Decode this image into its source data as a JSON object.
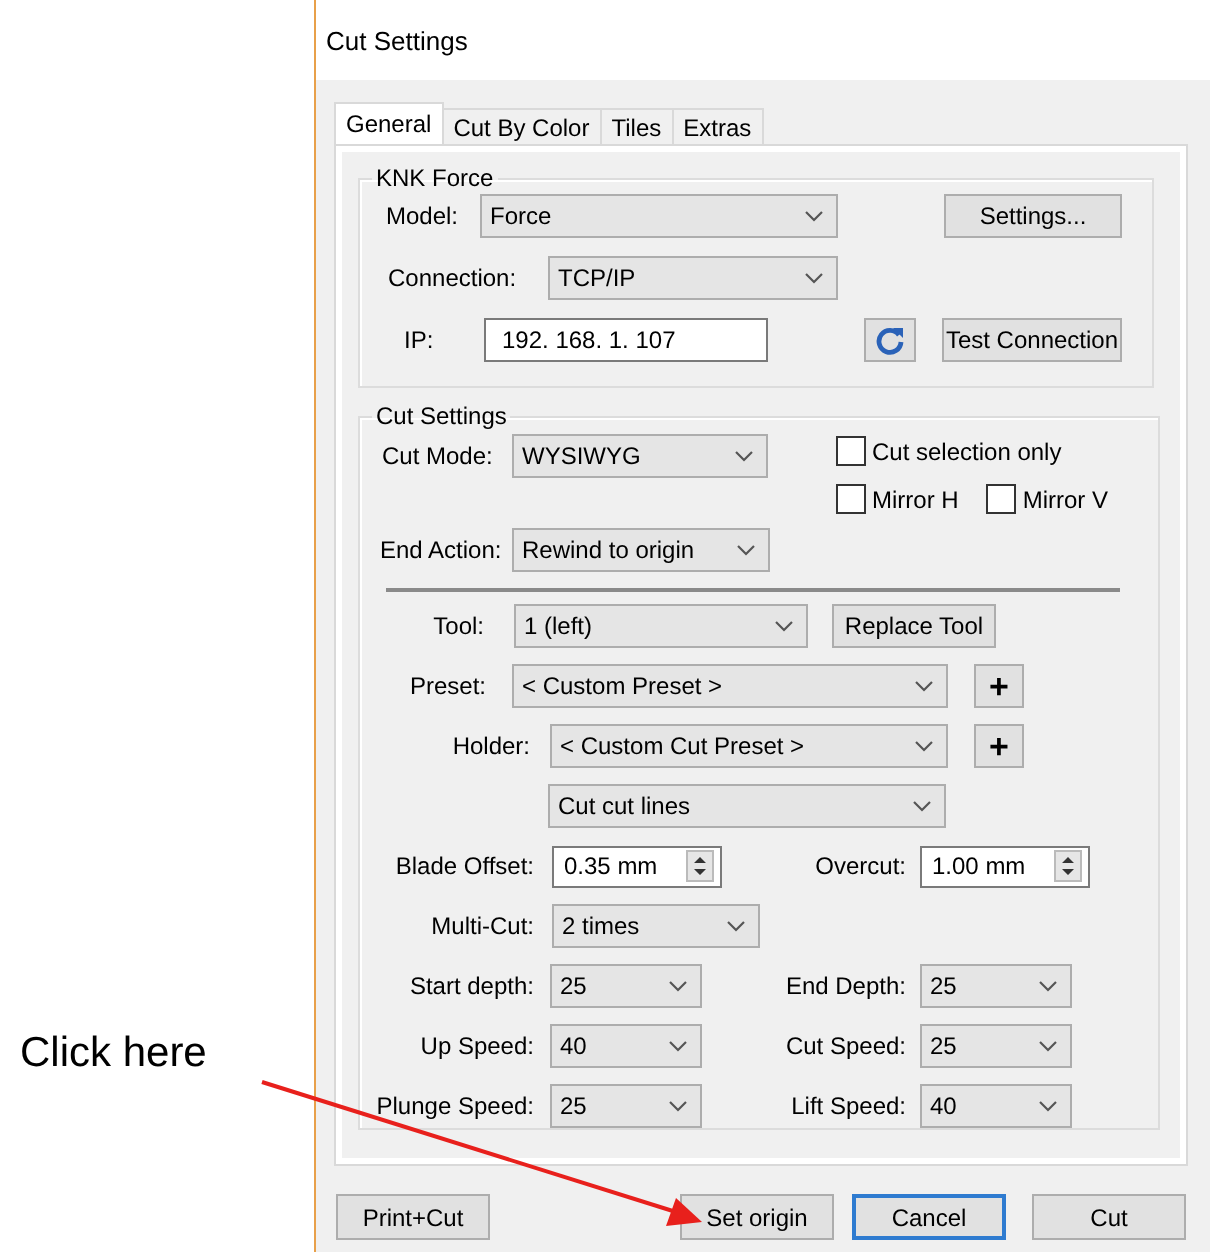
{
  "annotation": {
    "text": "Click here"
  },
  "dialog": {
    "title": "Cut Settings"
  },
  "tabs": [
    {
      "label": "General",
      "selected": true
    },
    {
      "label": "Cut By Color",
      "selected": false
    },
    {
      "label": "Tiles",
      "selected": false
    },
    {
      "label": "Extras",
      "selected": false
    }
  ],
  "knk_group": {
    "legend": "KNK Force",
    "model": {
      "label": "Model:",
      "value": "Force"
    },
    "settings_button": "Settings...",
    "connection": {
      "label": "Connection:",
      "value": "TCP/IP"
    },
    "ip": {
      "label": "IP:",
      "value": "192. 168. 1. 107"
    },
    "test_button": "Test Connection"
  },
  "cut_group": {
    "legend": "Cut Settings",
    "cut_mode": {
      "label": "Cut Mode:",
      "value": "WYSIWYG"
    },
    "cut_selection_only": {
      "label": "Cut selection only",
      "checked": false
    },
    "mirror_h": {
      "label": "Mirror H",
      "checked": false
    },
    "mirror_v": {
      "label": "Mirror V",
      "checked": false
    },
    "end_action": {
      "label": "End Action:",
      "value": "Rewind to origin"
    },
    "tool": {
      "label": "Tool:",
      "value": "1 (left)"
    },
    "replace_tool_button": "Replace Tool",
    "preset": {
      "label": "Preset:",
      "value": "< Custom Preset >",
      "plus": "+"
    },
    "holder": {
      "label": "Holder:",
      "value": "< Custom Cut Preset >",
      "plus": "+"
    },
    "cut_lines": {
      "value": "Cut cut lines"
    },
    "blade_offset": {
      "label": "Blade Offset:",
      "value": "0.35 mm"
    },
    "overcut": {
      "label": "Overcut:",
      "value": "1.00 mm"
    },
    "multi_cut": {
      "label": "Multi-Cut:",
      "value": "2 times"
    },
    "pairs": [
      {
        "left": {
          "label": "Start depth:",
          "value": "25"
        },
        "right": {
          "label": "End Depth:",
          "value": "25"
        }
      },
      {
        "left": {
          "label": "Up Speed:",
          "value": "40"
        },
        "right": {
          "label": "Cut Speed:",
          "value": "25"
        }
      },
      {
        "left": {
          "label": "Plunge Speed:",
          "value": "25"
        },
        "right": {
          "label": "Lift Speed:",
          "value": "40"
        }
      }
    ]
  },
  "buttons": [
    {
      "label": "Print+Cut",
      "default": false
    },
    {
      "label": "Set origin",
      "default": false
    },
    {
      "label": "Cancel",
      "default": true
    },
    {
      "label": "Cut",
      "default": false
    }
  ]
}
